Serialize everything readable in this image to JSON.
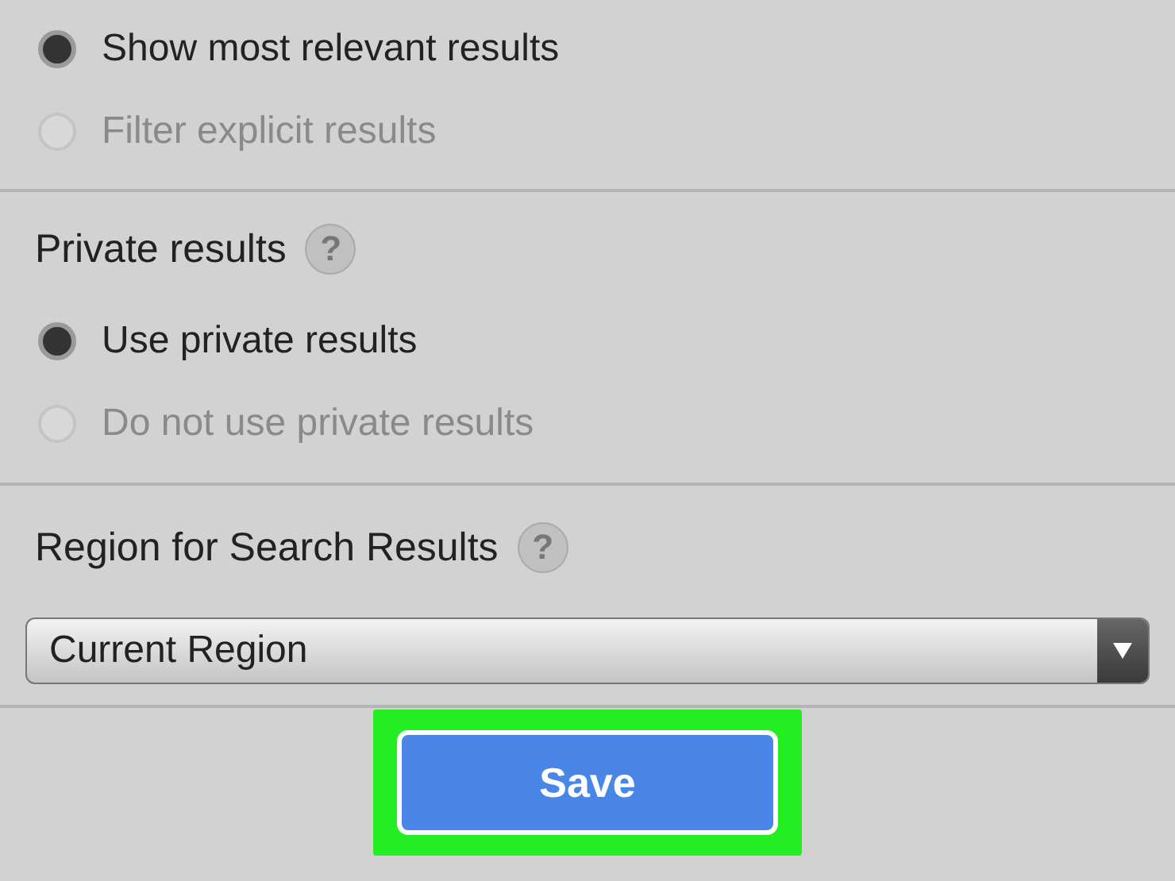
{
  "sections": [
    {
      "radios": [
        {
          "label": "Show most relevant results",
          "selected": true
        },
        {
          "label": "Filter explicit results",
          "selected": false
        }
      ]
    },
    {
      "title": "Private results",
      "help": "?",
      "radios": [
        {
          "label": "Use private results",
          "selected": true
        },
        {
          "label": "Do not use private results",
          "selected": false
        }
      ]
    },
    {
      "title": "Region for Search Results",
      "help": "?",
      "select": {
        "value": "Current Region"
      }
    }
  ],
  "save_button": {
    "label": "Save",
    "highlighted": true
  }
}
